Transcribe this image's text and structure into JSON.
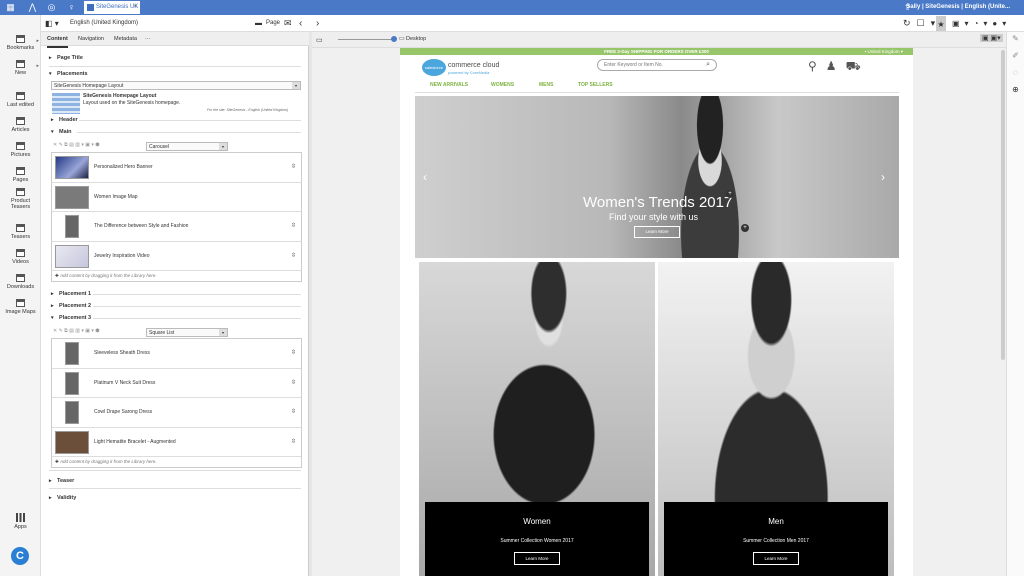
{
  "topbar": {
    "tab_title": "SiteGenesis UK",
    "tab_close": "×",
    "user_line": "Sally | SiteGenesis | English (Unite..."
  },
  "rail": {
    "items": [
      "Bookmarks",
      "New",
      "Last edited",
      "Articles",
      "Pictures",
      "Pages",
      "Product Teasers",
      "Teasers",
      "Videos",
      "Downloads",
      "Image Maps"
    ],
    "apps": "Apps"
  },
  "toolbar": {
    "locale": "English (United Kingdom)",
    "page_label": "Page",
    "device": "Desktop"
  },
  "panel": {
    "tabs": [
      "Content",
      "Navigation",
      "Metadata",
      "···"
    ],
    "page_title": "Page Title",
    "placements": "Placements",
    "layout_select": "SiteGenesis Homepage Layout",
    "layout_name": "SiteGenesis Homepage Layout",
    "layout_desc": "Layout used on the SiteGenesis homepage.",
    "layout_site": "For the site: SiteGenesis - English (United Kingdom)",
    "header": "Header",
    "main": "Main",
    "main_view": "Carousel",
    "main_items": [
      "Personalized Hero Banner",
      "Women Image Map",
      "The Difference between Style and Fashion",
      "Jewelry Inspiration Video"
    ],
    "add_hint": "Add content by dragging it from the Library here.",
    "placement1": "Placement 1",
    "placement2": "Placement 2",
    "placement3": "Placement 3",
    "p3_view": "Square List",
    "p3_items": [
      "Sleeveless Sheath Dress",
      "Platinum V Neck Suit Dress",
      "Cowl Drape Sarong Dress",
      "Light Hematite Bracelet - Augmented"
    ],
    "teaser": "Teaser",
    "validity": "Validity"
  },
  "site": {
    "shipping": "FREE 2-Day SHIPPING FOR ORDERS OVER £300",
    "country": "United Kingdom",
    "logo": "salesforce",
    "brand": "commerce cloud",
    "brand_sub": "powered by CoreMedia",
    "search_placeholder": "Enter Keyword or Item No.",
    "nav": [
      "NEW ARRIVALS",
      "WOMENS",
      "MENS",
      "TOP SELLERS"
    ],
    "hero_title": "Women's Trends 2017",
    "hero_sub": "Find your style with us",
    "hero_btn": "Learn More",
    "tiles": [
      {
        "title": "Women",
        "sub": "Summer Collection Women 2017",
        "btn": "Learn More"
      },
      {
        "title": "Men",
        "sub": "Summer Collection Men 2017",
        "btn": "Learn More"
      }
    ]
  },
  "colors": {
    "topbar": "#4a7ac7",
    "accent_green": "#97c56a",
    "nav_green": "#7cb342"
  }
}
